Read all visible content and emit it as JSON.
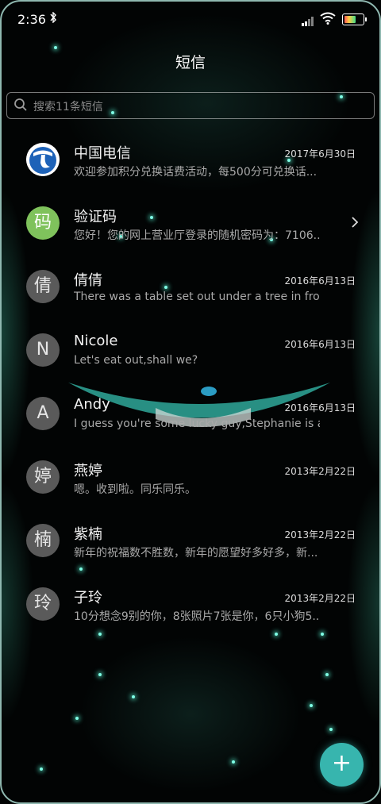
{
  "status": {
    "time": "2:36",
    "bluetooth_icon": "bluetooth-icon",
    "signal_icon": "signal-icon",
    "wifi_icon": "wifi-icon",
    "battery_icon": "battery-icon"
  },
  "header": {
    "title": "短信"
  },
  "search": {
    "placeholder": "搜索11条短信"
  },
  "conversations": [
    {
      "avatar": "",
      "name": "中国电信",
      "date": "2017年6月30日",
      "preview": "欢迎参加积分兑换话费活动，每500分可兑换话..."
    },
    {
      "avatar": "码",
      "name": "验证码",
      "date": "",
      "preview": "您好！您的网上营业厅登录的随机密码为：7106..."
    },
    {
      "avatar": "倩",
      "name": "倩倩",
      "date": "2016年6月13日",
      "preview": "There was a table set out under a tree in fron..."
    },
    {
      "avatar": "N",
      "name": "Nicole",
      "date": "2016年6月13日",
      "preview": "Let's eat out,shall we?"
    },
    {
      "avatar": "A",
      "name": "Andy",
      "date": "2016年6月13日",
      "preview": "I guess you're some lucky guy,Stephanie is a..."
    },
    {
      "avatar": "婷",
      "name": "燕婷",
      "date": "2013年2月22日",
      "preview": "嗯。收到啦。同乐同乐。"
    },
    {
      "avatar": "楠",
      "name": "紫楠",
      "date": "2013年2月22日",
      "preview": "新年的祝福数不胜数，新年的愿望好多好多，新..."
    },
    {
      "avatar": "玲",
      "name": "子玲",
      "date": "2013年2月22日",
      "preview": "10分想念9别的你，8张照片7张是你，6只小狗5..."
    }
  ],
  "fab": {
    "label": "+",
    "icon": "plus-icon"
  },
  "colors": {
    "accent": "#37b5ae",
    "background": "#020404",
    "glow": "#7fffe6"
  }
}
